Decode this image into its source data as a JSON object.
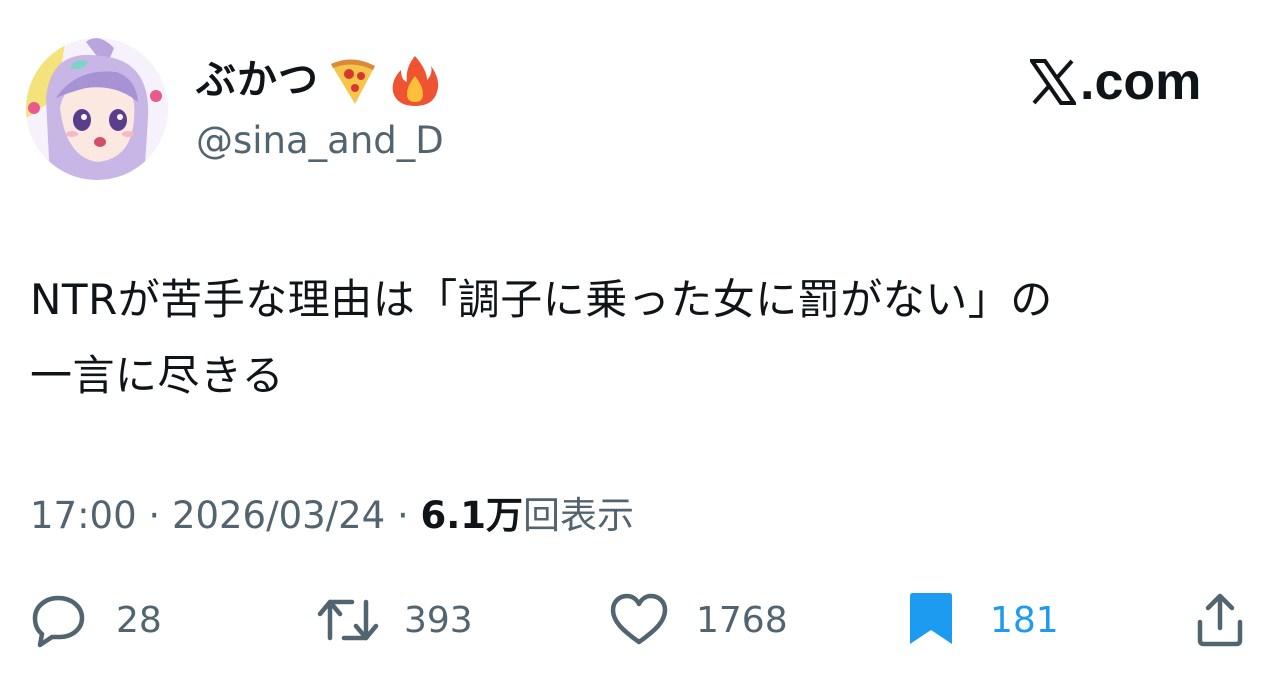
{
  "user": {
    "display_name": "ぶかつ",
    "name_emojis": [
      "pizza-icon",
      "fire-icon"
    ],
    "handle": "@sina_and_D"
  },
  "brand": {
    "label": ".com",
    "logo_icon": "x-logo-icon"
  },
  "tweet": {
    "text_lines": [
      "NTRが苦手な理由は「調子に乗った女に罰がない」の",
      "一言に尽きる"
    ]
  },
  "meta": {
    "time": "17:00",
    "separator": "·",
    "date": "2026/03/24",
    "views_count": "6.1万",
    "views_label": "回表示"
  },
  "actions": {
    "reply": {
      "icon": "reply-icon",
      "count": "28"
    },
    "retweet": {
      "icon": "retweet-icon",
      "count": "393"
    },
    "like": {
      "icon": "heart-icon",
      "count": "1768"
    },
    "bookmark": {
      "icon": "bookmark-icon",
      "count": "181",
      "active": true
    },
    "share": {
      "icon": "share-icon"
    }
  },
  "colors": {
    "text": "#0f1419",
    "secondary": "#536471",
    "accent": "#1d9bf0"
  }
}
